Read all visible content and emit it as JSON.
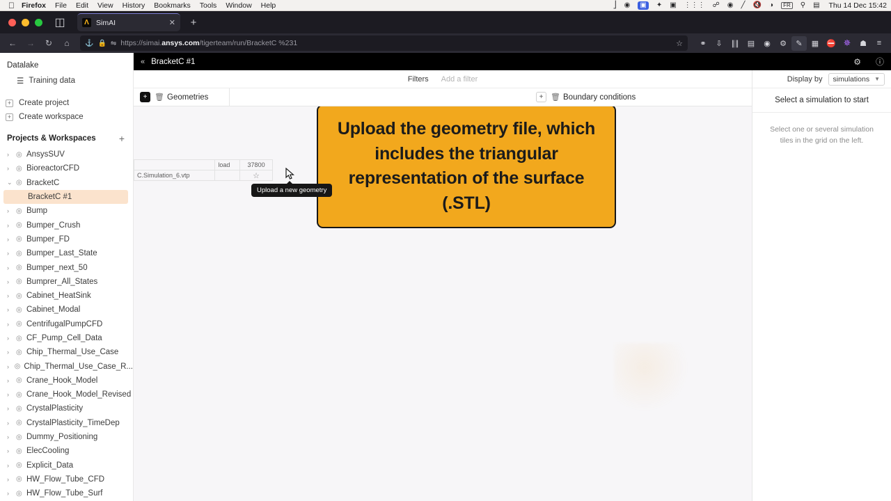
{
  "os_menu": {
    "apple_icon": "apple-logo",
    "items": [
      "Firefox",
      "File",
      "Edit",
      "View",
      "History",
      "Bookmarks",
      "Tools",
      "Window",
      "Help"
    ],
    "status_icons": [
      "bluetooth-icon",
      "dropbox-icon",
      "display-icon",
      "dropbox-sync-icon",
      "photos-icon",
      "grid-icon",
      "headphones-icon",
      "record-icon",
      "pencil-icon",
      "volume-mute-icon",
      "wifi-icon"
    ],
    "input_source": "FR",
    "search_icon": "search-icon",
    "control_center_icon": "control-center-icon",
    "clock": "Thu 14 Dec  15:42"
  },
  "browser": {
    "tab": {
      "favicon": "ansys-logo-icon",
      "title": "SimAI",
      "close_icon": "close-icon"
    },
    "new_tab_label": "+",
    "sidebar_icon": "firefox-view-icon",
    "nav": {
      "back_icon": "back-arrow-icon",
      "forward_icon": "forward-arrow-icon",
      "reload_icon": "reload-icon",
      "home_icon": "home-icon"
    },
    "url": {
      "shield_icon": "shield-icon",
      "lock_icon": "lock-icon",
      "container_icon": "container-tabs-icon",
      "prefix": "https://simai.",
      "domain": "ansys.com",
      "path": "/tigerteam/run/BracketC %231",
      "bookmark_icon": "star-icon"
    },
    "extensions": [
      "pocket-icon",
      "download-icon",
      "library-icon",
      "reader-icon",
      "grammarly-icon",
      "settings-ext-icon",
      "notes-icon",
      "columns-icon",
      "ublock-icon",
      "orbit-icon",
      "pin-icon",
      "menu-icon"
    ]
  },
  "app_header": {
    "collapse_icon": "double-chevron-left-icon",
    "title": "BracketC #1",
    "settings_icon": "gear-icon",
    "help_icon": "help-circle-icon"
  },
  "sidebar": {
    "datalake_title": "Datalake",
    "training_data": {
      "label": "Training data",
      "icon": "layers-icon"
    },
    "create_project": {
      "label": "Create project",
      "icon": "plus-box-icon"
    },
    "create_workspace": {
      "label": "Create workspace",
      "icon": "plus-box-icon"
    },
    "section_title": "Projects & Workspaces",
    "section_add_icon": "plus-icon",
    "projects": [
      {
        "label": "AnsysSUV",
        "expanded": false
      },
      {
        "label": "BioreactorCFD",
        "expanded": false
      },
      {
        "label": "BracketC",
        "expanded": true
      },
      {
        "label": "Bump",
        "expanded": false
      },
      {
        "label": "Bumper_Crush",
        "expanded": false
      },
      {
        "label": "Bumper_FD",
        "expanded": false
      },
      {
        "label": "Bumper_Last_State",
        "expanded": false
      },
      {
        "label": "Bumper_next_50",
        "expanded": false
      },
      {
        "label": "Bumprer_All_States",
        "expanded": false
      },
      {
        "label": "Cabinet_HeatSink",
        "expanded": false
      },
      {
        "label": "Cabinet_Modal",
        "expanded": false
      },
      {
        "label": "CentrifugalPumpCFD",
        "expanded": false
      },
      {
        "label": "CF_Pump_Cell_Data",
        "expanded": false
      },
      {
        "label": "Chip_Thermal_Use_Case",
        "expanded": false
      },
      {
        "label": "Chip_Thermal_Use_Case_R...",
        "expanded": false
      },
      {
        "label": "Crane_Hook_Model",
        "expanded": false
      },
      {
        "label": "Crane_Hook_Model_Revised",
        "expanded": false
      },
      {
        "label": "CrystalPlasticity",
        "expanded": false
      },
      {
        "label": "CrystalPlasticity_TimeDep",
        "expanded": false
      },
      {
        "label": "Dummy_Positioning",
        "expanded": false
      },
      {
        "label": "ElecCooling",
        "expanded": false
      },
      {
        "label": "Explicit_Data",
        "expanded": false
      },
      {
        "label": "HW_Flow_Tube_CFD",
        "expanded": false
      },
      {
        "label": "HW_Flow_Tube_Surf",
        "expanded": false
      }
    ],
    "selected_child": "BracketC #1"
  },
  "filters": {
    "label": "Filters",
    "placeholder": "Add a filter"
  },
  "panels": {
    "geometries": {
      "title": "Geometries",
      "add_icon": "plus-icon",
      "delete_icon": "trash-icon"
    },
    "boundary_conditions": {
      "title": "Boundary conditions",
      "add_icon": "plus-icon",
      "delete_icon": "trash-icon"
    }
  },
  "tooltip": {
    "text": "Upload a new geometry"
  },
  "table": {
    "rows": [
      {
        "col1": "",
        "col2": "load",
        "col3": "37800"
      },
      {
        "col1": "C.Simulation_6.vtp",
        "col2": "",
        "col3": "star-icon"
      }
    ]
  },
  "banner": {
    "text": "Upload the geometry file, which includes the triangular representation of the surface (.STL)",
    "background_color": "#f2a81d",
    "border_color": "#171717",
    "text_color": "#1b1b1b"
  },
  "right_panel": {
    "display_by_label": "Display by",
    "display_by_value": "simulations",
    "chevron_icon": "chevron-down-icon",
    "title": "Select a simulation to start",
    "description": "Select one or several simulation tiles in the grid on the left."
  }
}
